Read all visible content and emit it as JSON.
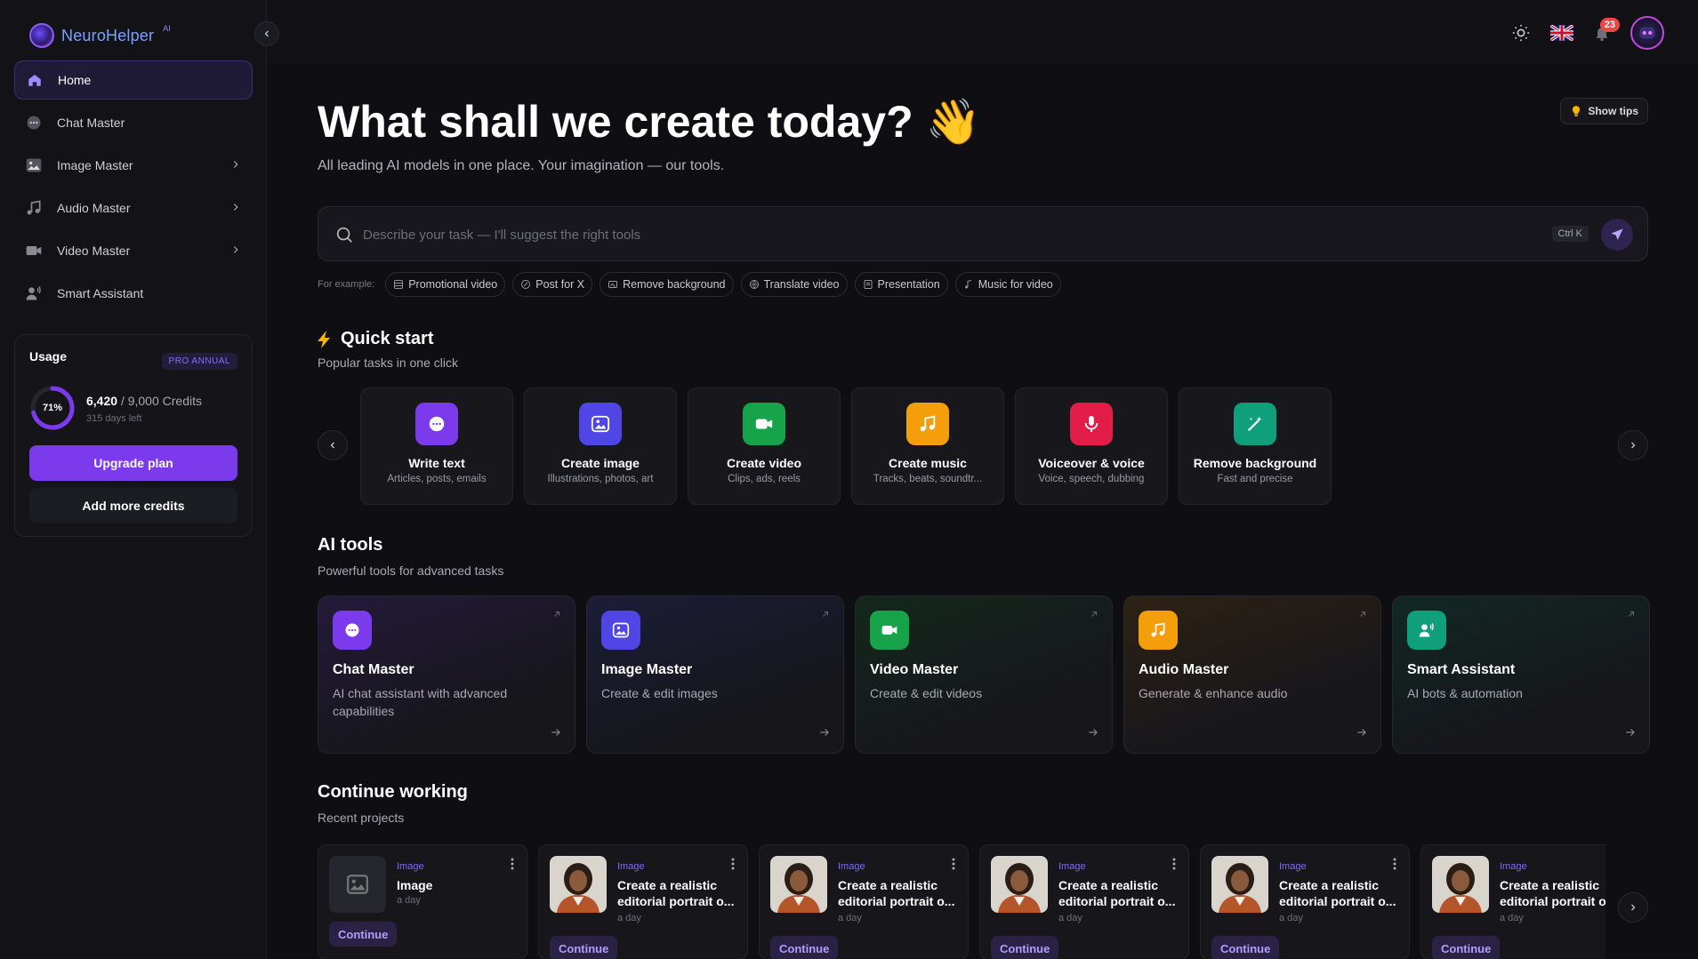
{
  "app": {
    "logo_text": "NeuroHelper",
    "logo_sup": "AI"
  },
  "sidebar": {
    "items": [
      {
        "label": "Home",
        "icon": "home-icon",
        "active": true
      },
      {
        "label": "Chat Master",
        "icon": "chat-icon"
      },
      {
        "label": "Image Master",
        "icon": "image-icon"
      },
      {
        "label": "Audio Master",
        "icon": "music-icon"
      },
      {
        "label": "Video Master",
        "icon": "video-icon"
      },
      {
        "label": "Smart Assistant",
        "icon": "assistant-icon"
      }
    ]
  },
  "usage": {
    "title": "Usage",
    "plan": "PRO ANNUAL",
    "percent_label": "71%",
    "percent": 71,
    "credits_used": "6,420",
    "credits_total": "/ 9,000 Credits",
    "days_left": "315 days left",
    "upgrade_label": "Upgrade plan",
    "add_credits_label": "Add more credits"
  },
  "topbar": {
    "notifications_count": "23"
  },
  "hero": {
    "title": "What shall we create today?",
    "emoji": "👋",
    "subtitle": "All leading AI models in one place. Your imagination — our tools.",
    "tips_label": "Show tips"
  },
  "search": {
    "placeholder": "Describe your task — I'll suggest the right tools",
    "shortcut": "Ctrl K"
  },
  "examples": {
    "label": "For example:",
    "chips": [
      "Promotional video",
      "Post for X",
      "Remove background",
      "Translate video",
      "Presentation",
      "Music for video"
    ]
  },
  "quick_start": {
    "title": "Quick start",
    "subtitle": "Popular tasks in one click",
    "cards": [
      {
        "title": "Write text",
        "subtitle": "Articles, posts, emails",
        "color": "#7c3aed",
        "icon": "chat-icon"
      },
      {
        "title": "Create image",
        "subtitle": "Illustrations, photos, art",
        "color": "#4f46e5",
        "icon": "image-icon"
      },
      {
        "title": "Create video",
        "subtitle": "Clips, ads, reels",
        "color": "#16a34a",
        "icon": "video-icon"
      },
      {
        "title": "Create music",
        "subtitle": "Tracks, beats, soundtr...",
        "color": "#f59e0b",
        "icon": "music-icon"
      },
      {
        "title": "Voiceover & voice",
        "subtitle": "Voice, speech, dubbing",
        "color": "#e11d48",
        "icon": "mic-icon"
      },
      {
        "title": "Remove background",
        "subtitle": "Fast and precise",
        "color": "#0f9f7a",
        "icon": "wand-icon"
      }
    ]
  },
  "ai_tools": {
    "title": "AI tools",
    "subtitle": "Powerful tools for advanced tasks",
    "cards": [
      {
        "title": "Chat Master",
        "subtitle": "AI chat assistant with advanced capabilities",
        "color": "#7c3aed",
        "tint": "#241a3a",
        "icon": "chat-icon"
      },
      {
        "title": "Image Master",
        "subtitle": "Create & edit images",
        "color": "#4f46e5",
        "tint": "#1c1d38",
        "icon": "image-icon"
      },
      {
        "title": "Video Master",
        "subtitle": "Create & edit videos",
        "color": "#16a34a",
        "tint": "#14281c",
        "icon": "video-icon"
      },
      {
        "title": "Audio Master",
        "subtitle": "Generate & enhance audio",
        "color": "#f59e0b",
        "tint": "#2e2214",
        "icon": "music-icon"
      },
      {
        "title": "Smart Assistant",
        "subtitle": "AI bots & automation",
        "color": "#0f9f7a",
        "tint": "#122824",
        "icon": "assistant-icon"
      }
    ]
  },
  "continue_working": {
    "title": "Continue working",
    "subtitle": "Recent projects",
    "continue_label": "Continue",
    "projects": [
      {
        "type": "Image",
        "title": "Image",
        "time": "a day",
        "placeholder": true
      },
      {
        "type": "Image",
        "title": "Create a realistic editorial portrait o...",
        "time": "a day"
      },
      {
        "type": "Image",
        "title": "Create a realistic editorial portrait o...",
        "time": "a day"
      },
      {
        "type": "Image",
        "title": "Create a realistic editorial portrait o...",
        "time": "a day"
      },
      {
        "type": "Image",
        "title": "Create a realistic editorial portrait o...",
        "time": "a day"
      },
      {
        "type": "Image",
        "title": "Create a realistic editorial portrait o",
        "time": "a day"
      }
    ]
  }
}
